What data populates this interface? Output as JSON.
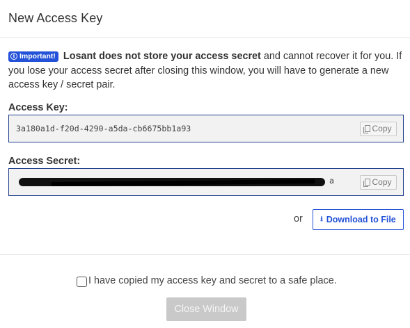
{
  "dialog": {
    "title": "New Access Key"
  },
  "notice": {
    "badge_label": "Important!",
    "badge_icon": "info-icon",
    "bold_text": "Losant does not store your access secret",
    "rest_text": " and cannot recover it for you. If you lose your access secret after closing this window, you will have to generate a new access key / secret pair."
  },
  "access_key": {
    "label": "Access Key:",
    "value": "3a180a1d-f20d-4290-a5da-cb6675bb1a93",
    "copy_label": "Copy"
  },
  "access_secret": {
    "label": "Access Secret:",
    "visible_tail": "a",
    "copy_label": "Copy"
  },
  "download": {
    "or_text": "or",
    "button_label": "Download to File",
    "icon": "download-icon"
  },
  "footer": {
    "confirm_label": "I have copied my access key and secret to a safe place.",
    "confirm_checked": false,
    "close_label": "Close Window"
  },
  "colors": {
    "accent": "#2352d8",
    "field_border": "#1f3e8c",
    "disabled_button": "#c9c9c9"
  }
}
